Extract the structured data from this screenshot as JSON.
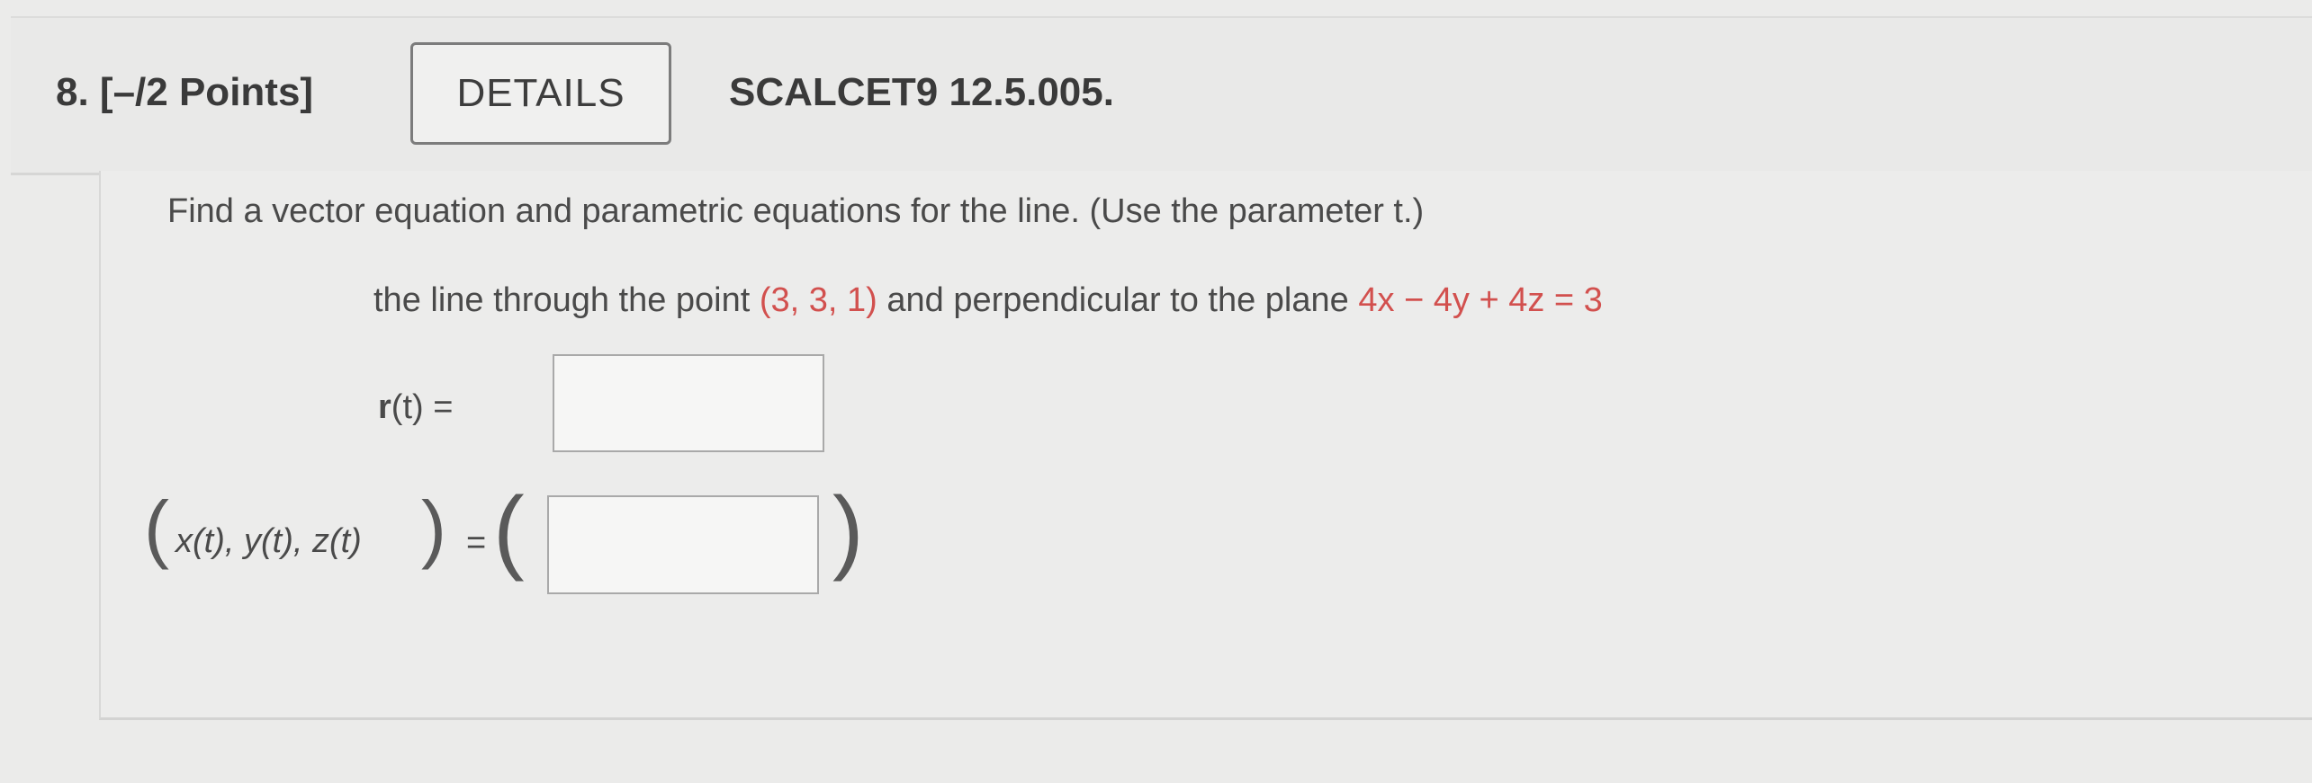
{
  "question": {
    "number_label": "8. [–/2 Points]",
    "details_label": "DETAILS",
    "course_code": "SCALCET9 12.5.005."
  },
  "problem": {
    "instruction": "Find a vector equation and parametric equations for the line. (Use the parameter t.)",
    "statement_prefix": "the line through the point ",
    "point": "(3, 3, 1)",
    "statement_middle": " and perpendicular to the plane ",
    "plane": "4x − 4y + 4z = 3"
  },
  "answers": {
    "vector_label_bold": "r",
    "vector_label_rest": "(t)  =",
    "vector_value": "",
    "parametric_label": "x(t), y(t), z(t)",
    "parametric_equals": "=",
    "parametric_value": ""
  },
  "colors": {
    "highlight": "#d2504e"
  }
}
